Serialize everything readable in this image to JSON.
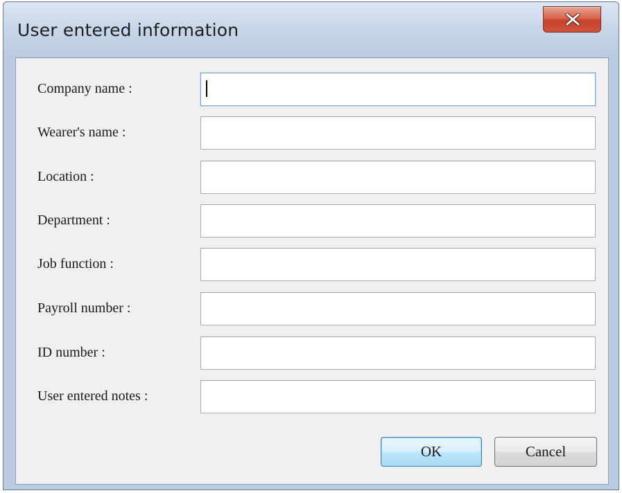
{
  "window": {
    "title": "User entered information"
  },
  "form": {
    "fields": [
      {
        "label": "Company name :",
        "value": "",
        "focused": true
      },
      {
        "label": "Wearer's name :",
        "value": ""
      },
      {
        "label": "Location :",
        "value": ""
      },
      {
        "label": "Department :",
        "value": ""
      },
      {
        "label": "Job function :",
        "value": ""
      },
      {
        "label": "Payroll number :",
        "value": ""
      },
      {
        "label": "ID number :",
        "value": ""
      },
      {
        "label": "User entered notes :",
        "value": ""
      }
    ]
  },
  "buttons": {
    "ok_label": "OK",
    "cancel_label": "Cancel"
  },
  "icons": {
    "close": "close-icon"
  },
  "colors": {
    "close_button": "#d0543d",
    "titlebar": "#c7d6e8",
    "client_bg": "#f0f0f0"
  }
}
